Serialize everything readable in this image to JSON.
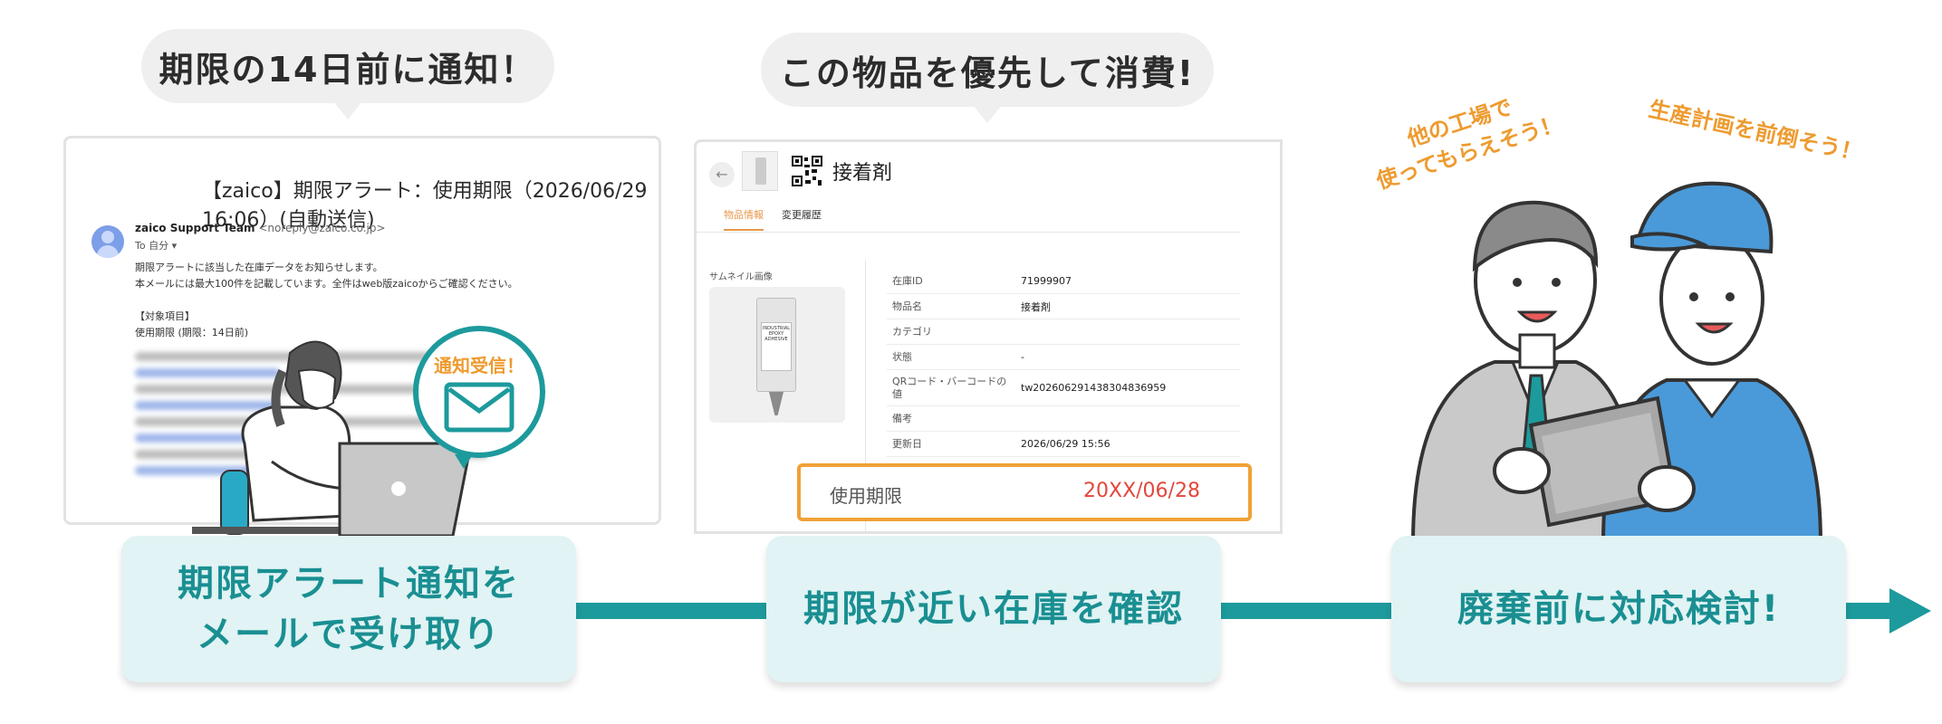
{
  "bubbles": {
    "step1": "期限の14日前に通知！",
    "step2": "この物品を優先して消費!"
  },
  "email": {
    "subject": "【zaico】期限アラート：使用期限（2026/06/29 16:06）(自動送信)",
    "from_name": "zaico Support Team",
    "from_address": "<noreply@zaico.co.jp>",
    "to": "To 自分 ▾",
    "body_lines": [
      "期限アラートに該当した在庫データをお知らせします。",
      "本メールには最大100件を記載しています。全件はweb版zaicoからご確認ください。",
      "",
      "【対象項目】",
      "使用期限 (期限：14日前)"
    ]
  },
  "notification": {
    "label": "通知受信！"
  },
  "inventory": {
    "title": "接着剤",
    "tabs": [
      "物品情報",
      "変更履歴"
    ],
    "thumbnail_label": "サムネイル画像",
    "product_label": [
      "INDUSTRIAL",
      "EPOXY",
      "ADHESIVE"
    ],
    "rows": [
      {
        "key": "在庫ID",
        "value": "71999907"
      },
      {
        "key": "物品名",
        "value": "接着剤"
      },
      {
        "key": "カテゴリ",
        "value": ""
      },
      {
        "key": "状態",
        "value": "-"
      },
      {
        "key": "QRコード・バーコードの値",
        "value": "tw20260629143830483695​9"
      },
      {
        "key": "備考",
        "value": ""
      },
      {
        "key": "更新日",
        "value": "2026/06/29 15:56"
      }
    ],
    "expiry_label": "使用期限",
    "expiry_value": "20XX/06/28"
  },
  "workers": {
    "note_left_line1": "他の工場で",
    "note_left_line2": "使ってもらえそう！",
    "note_right": "生産計画を前倒そう！"
  },
  "steps": {
    "step1_line1": "期限アラート通知を",
    "step1_line2": "メールで受け取り",
    "step2": "期限が近い在庫を確認",
    "step3": "廃棄前に対応検討!"
  },
  "colors": {
    "teal": "#1d9a9c",
    "step_bg": "#e1f3f4",
    "accent_orange": "#ee9b2f",
    "expiry_red": "#e2473b"
  }
}
